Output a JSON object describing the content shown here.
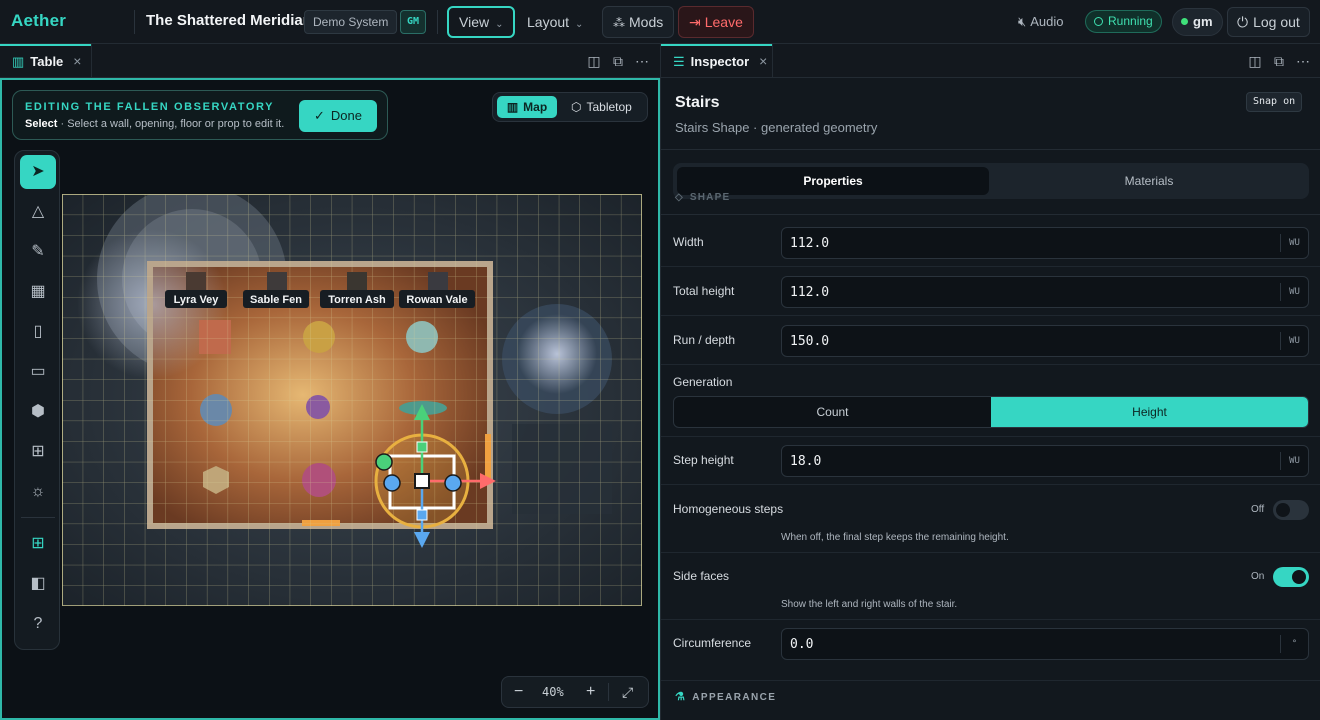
{
  "app": {
    "logo": "Aether",
    "title": "The Shattered Meridian",
    "system_chip": "Demo System",
    "role_chip": "GM"
  },
  "topbar": {
    "view_label": "View",
    "layout_label": "Layout",
    "mods_label": "Mods",
    "leave_label": "Leave",
    "audio_label": "Audio",
    "status_label": "Running",
    "user_label": "gm",
    "logout_label": "Log out"
  },
  "table_tab": {
    "label": "Table"
  },
  "editing": {
    "title": "EDITING THE FALLEN OBSERVATORY",
    "mode": "Select",
    "hint": " · Select a wall, opening, floor or prop to edit it.",
    "done_label": "Done"
  },
  "view_mode": {
    "map_label": "Map",
    "tabletop_label": "Tabletop"
  },
  "tokens": [
    "Lyra Vey",
    "Sable Fen",
    "Torren Ash",
    "Rowan Vale"
  ],
  "zoom": {
    "value": "40%"
  },
  "inspector": {
    "tab_label": "Inspector",
    "title": "Stairs",
    "subtitle": "Stairs Shape · generated geometry",
    "snap_label": "Snap on",
    "tabs": {
      "properties": "Properties",
      "materials": "Materials"
    },
    "section_shape": "SHAPE",
    "width": {
      "label": "Width",
      "value": "112.0",
      "unit": "WU"
    },
    "total_height": {
      "label": "Total height",
      "value": "112.0",
      "unit": "WU"
    },
    "run_depth": {
      "label": "Run / depth",
      "value": "150.0",
      "unit": "WU"
    },
    "generation": {
      "label": "Generation",
      "count": "Count",
      "height": "Height"
    },
    "step_height": {
      "label": "Step height",
      "value": "18.0",
      "unit": "WU"
    },
    "homogeneous": {
      "label": "Homogeneous steps",
      "state": "Off",
      "hint": "When off, the final step keeps the remaining height."
    },
    "side_faces": {
      "label": "Side faces",
      "state": "On",
      "hint": "Show the left and right walls of the stair."
    },
    "circumference": {
      "label": "Circumference",
      "value": "0.0",
      "unit": "°"
    },
    "section_appearance": "APPEARANCE"
  },
  "colors": {
    "accent": "#36d6c3",
    "danger": "#ff6b6b",
    "running": "#3fe0b0",
    "background": "#0f1419"
  }
}
